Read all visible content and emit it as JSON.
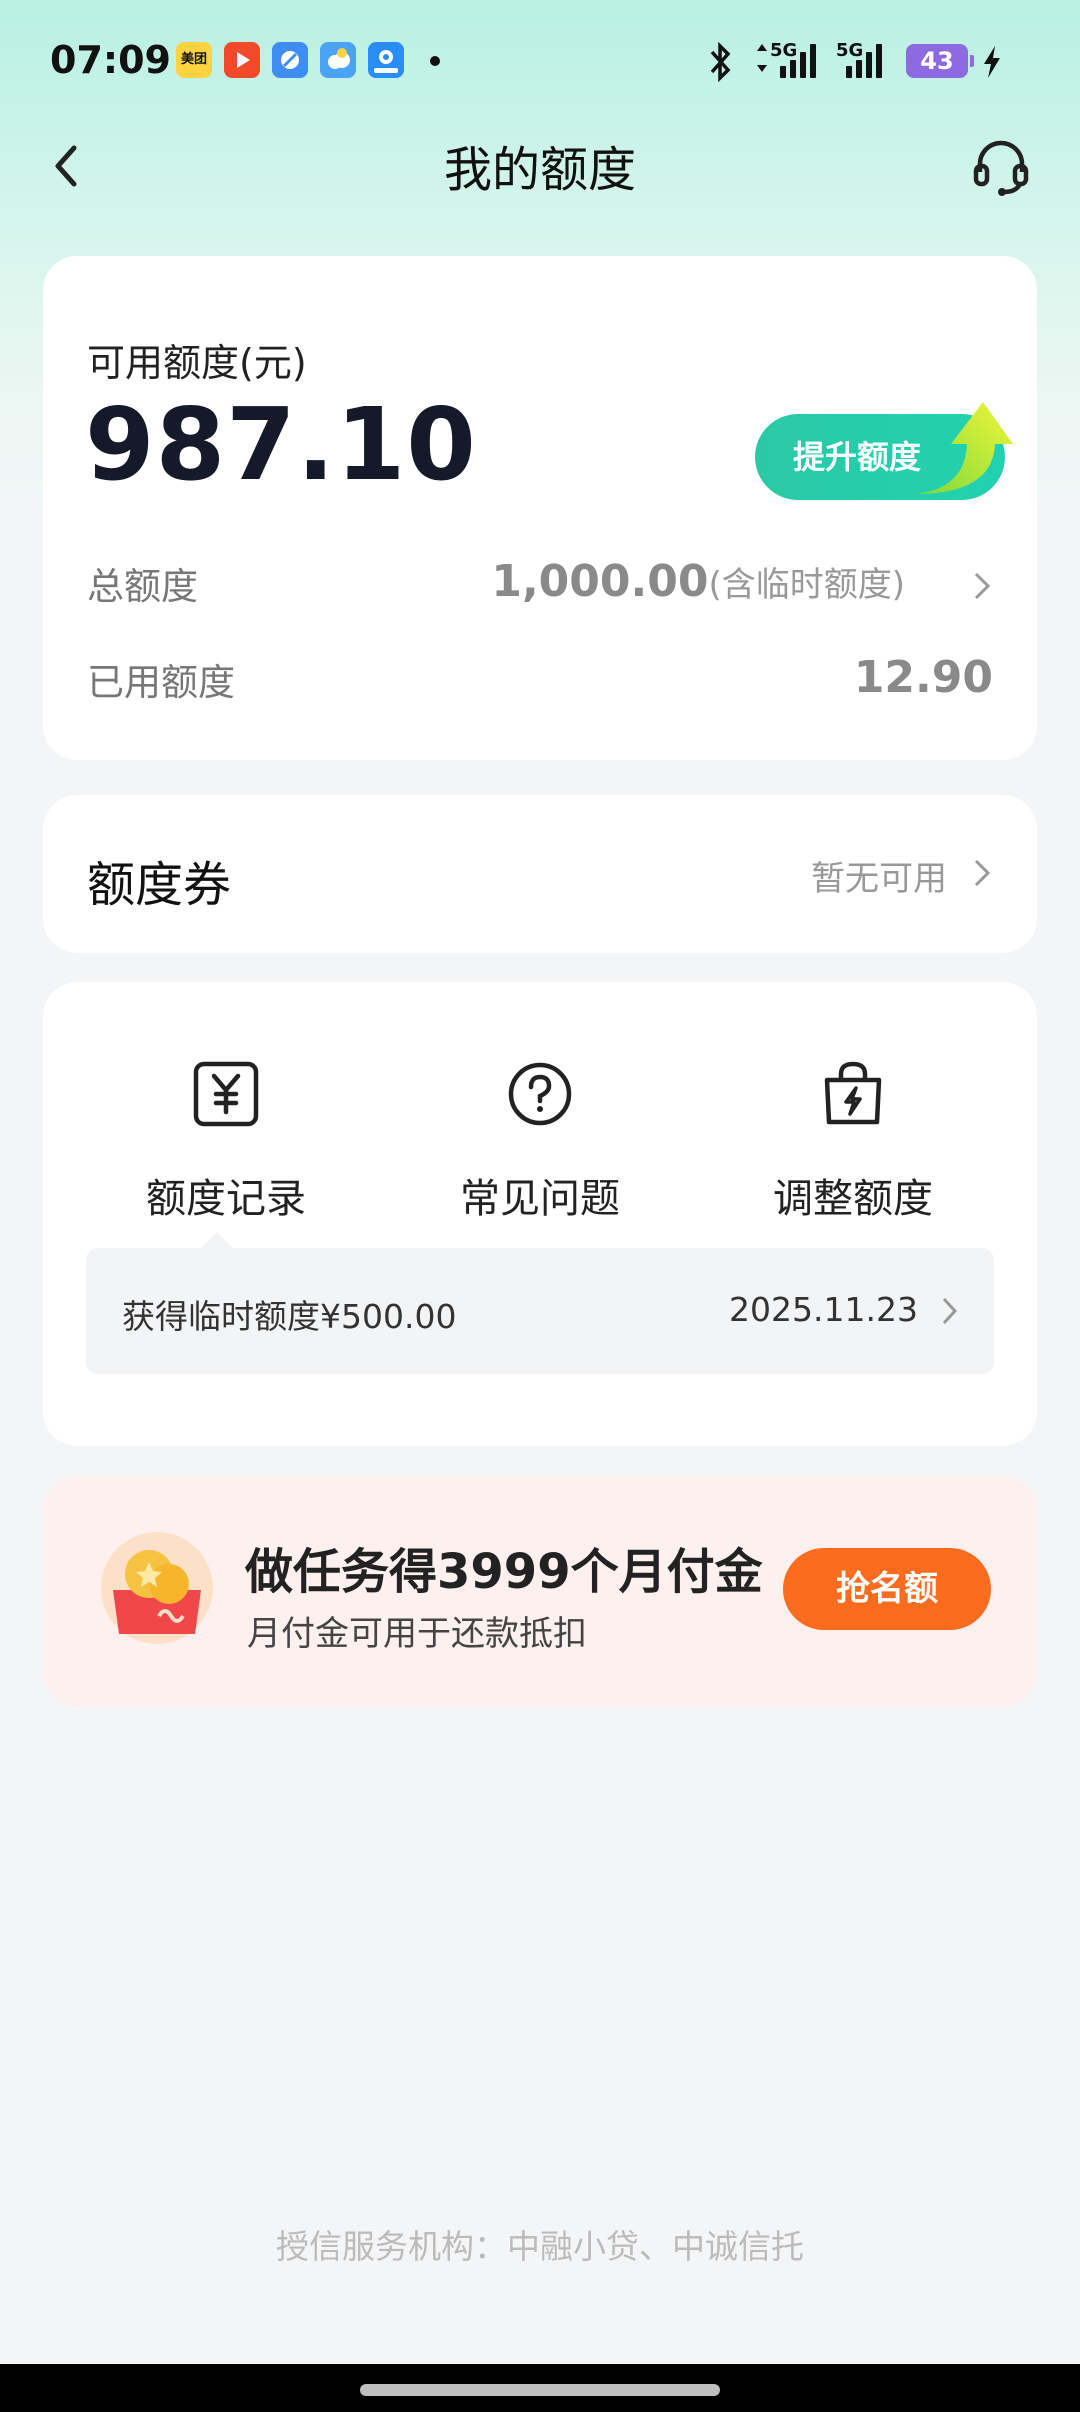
{
  "status_bar": {
    "time": "07:09",
    "apps": [
      "美团",
      "",
      "",
      "",
      ""
    ],
    "network_1": "5G",
    "network_2": "5G",
    "battery": "43"
  },
  "header": {
    "title": "我的额度"
  },
  "credit": {
    "available_label": "可用额度(元)",
    "available_amount": "987.10",
    "raise_button": "提升额度",
    "total_label": "总额度",
    "total_value": "1,000.00",
    "total_note": "(含临时额度)",
    "used_label": "已用额度",
    "used_value": "12.90"
  },
  "coupon": {
    "title": "额度券",
    "status": "暂无可用"
  },
  "tools": [
    {
      "label": "额度记录",
      "icon": "yen-receipt-icon"
    },
    {
      "label": "常见问题",
      "icon": "question-circle-icon"
    },
    {
      "label": "调整额度",
      "icon": "lightning-bag-icon"
    }
  ],
  "record": {
    "text": "获得临时额度¥500.00",
    "date": "2025.11.23"
  },
  "promo": {
    "title": "做任务得3999个月付金",
    "subtitle": "月付金可用于还款抵扣",
    "button": "抢名额"
  },
  "footer": {
    "text": "授信服务机构：中融小贷、中诚信托"
  },
  "colors": {
    "accent_green": "#22d1b0",
    "promo_orange": "#fb6c1e",
    "header_mint": "#b8f0e2"
  }
}
